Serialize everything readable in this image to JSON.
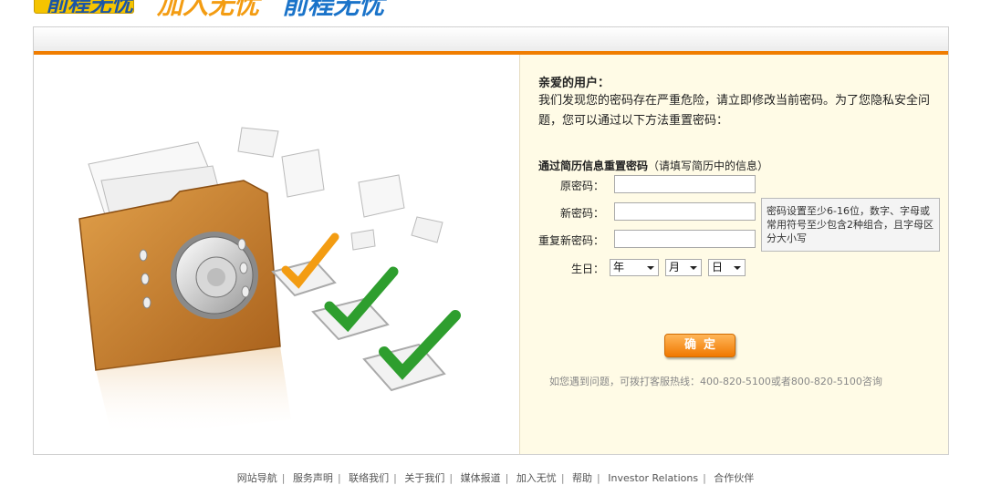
{
  "header": {
    "logo_text": "前程无忧",
    "slogan_part1": "加入无忧",
    "slogan_part2": "前程无忧"
  },
  "form": {
    "greeting": "亲爱的用户：",
    "message": "我们发现您的密码存在严重危险，请立即修改当前密码。为了您隐私安全问题，您可以通过以下方法重置密码：",
    "section_title": "通过简历信息重置密码",
    "section_note": "（请填写简历中的信息）",
    "old_password_label": "原密码：",
    "new_password_label": "新密码：",
    "repeat_password_label": "重复新密码：",
    "birthday_label": "生日：",
    "password_hint": "密码设置至少6-16位，数字、字母或常用符号至少包含2种组合，且字母区分大小写",
    "year_option": "年",
    "month_option": "月",
    "day_option": "日",
    "confirm_label": "确定",
    "hotline": "如您遇到问题，可拨打客服热线：400-820-5100或者800-820-5100咨询"
  },
  "footer": {
    "links": [
      "网站导航",
      "服务声明",
      "联络我们",
      "关于我们",
      "媒体报道",
      "加入无忧",
      "帮助",
      "Investor Relations",
      "合作伙伴"
    ]
  },
  "colors": {
    "accent_orange": "#f07d00",
    "right_pane_bg": "#fffbe6",
    "check_green": "#2e9e2e",
    "check_orange": "#f39c12",
    "folder_brown": "#c77d2a"
  },
  "icons": [
    "folder-safe-icon",
    "checkmark-icon",
    "paper-icon"
  ]
}
